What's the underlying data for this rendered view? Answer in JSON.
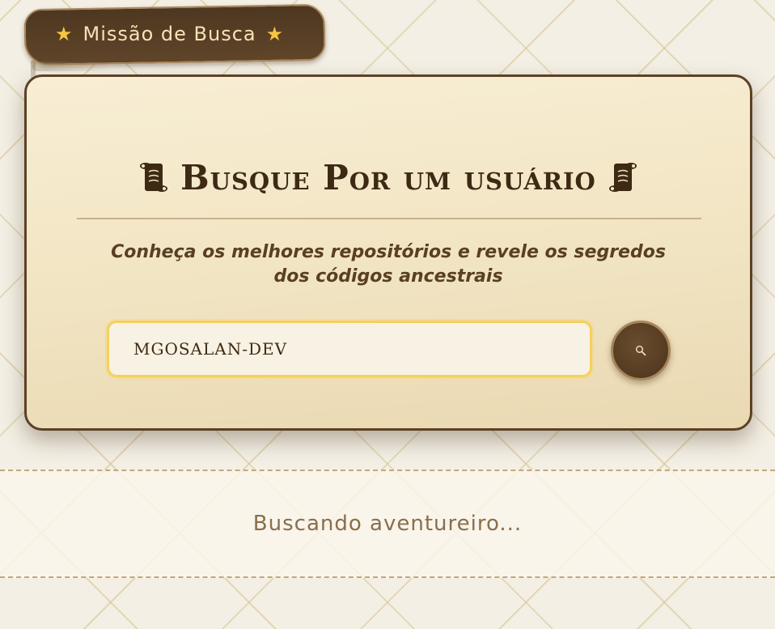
{
  "tag": {
    "label": "Missão de Busca",
    "star_left": "★",
    "star_right": "★"
  },
  "card": {
    "title": "Busque Por um usuário",
    "subtitle": "Conheça os melhores repositórios e revele os segredos dos códigos ancestrais"
  },
  "search": {
    "value": "MGOSALAN-DEV",
    "button_icon": "search-icon"
  },
  "status": {
    "text": "Buscando aventureiro..."
  },
  "colors": {
    "accent_brown": "#5c4125",
    "highlight_yellow": "#f5d05e",
    "parchment": "#f3e7c8"
  }
}
